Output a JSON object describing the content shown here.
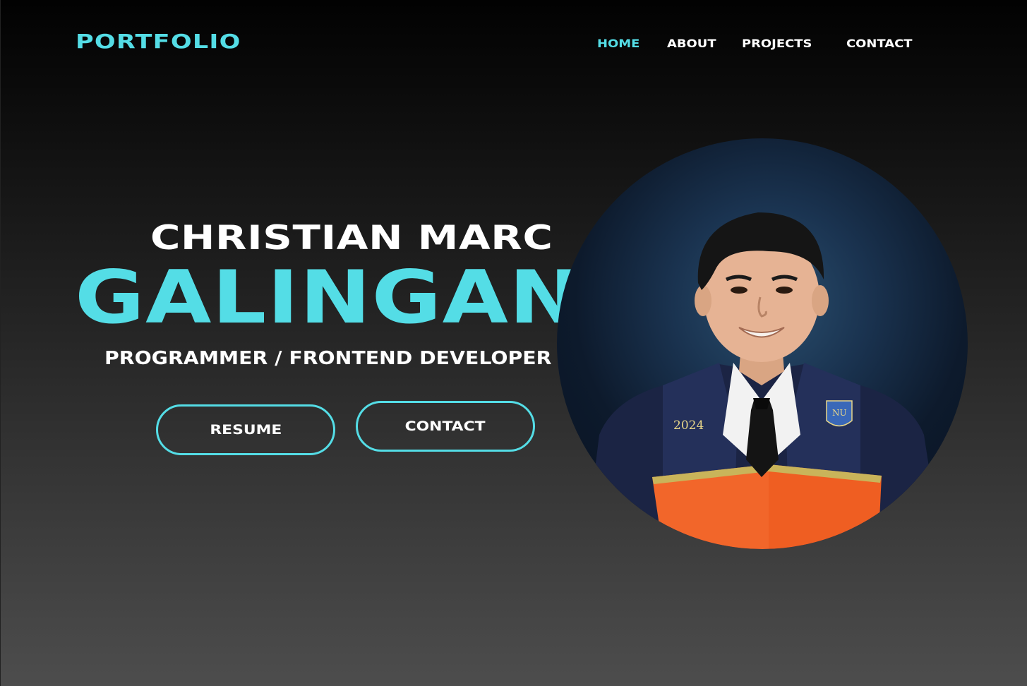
{
  "header": {
    "logo": "PORTFOLIO",
    "nav": [
      {
        "label": "HOME",
        "active": true
      },
      {
        "label": "ABOUT",
        "active": false
      },
      {
        "label": "PROJECTS",
        "active": false
      },
      {
        "label": "CONTACT",
        "active": false
      }
    ]
  },
  "hero": {
    "first_name": "CHRISTIAN MARC",
    "last_name": "GALINGAN",
    "role": "PROGRAMMER / FRONTEND DEVELOPER",
    "buttons": {
      "resume": "RESUME",
      "contact": "CONTACT"
    },
    "photo": {
      "stole_year": "2024",
      "badge_text": "NU"
    }
  },
  "colors": {
    "accent": "#54dde6",
    "text": "#ffffff",
    "background_top": "#020202",
    "background_bottom": "#4d4d4d"
  }
}
